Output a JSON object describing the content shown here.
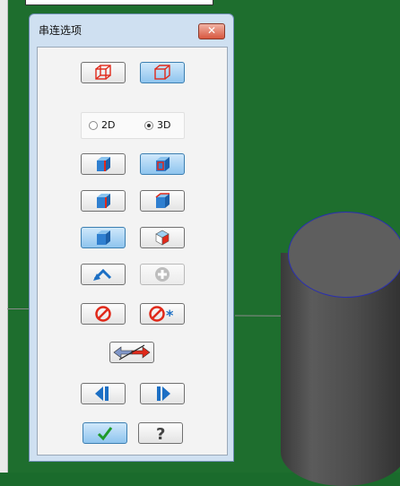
{
  "dialog": {
    "title": "串连选项",
    "close_label": "✕",
    "dimension": {
      "options": [
        "2D",
        "3D"
      ],
      "selected": "3D"
    }
  },
  "icons": {
    "wireframe_cube": "wireframe-cube-icon",
    "solid_cube": "solid-cube-icon",
    "face_cube": "face-cube-icon",
    "undo": "undo-arrow-icon",
    "add": "plus-circle-icon",
    "no": "prohibit-icon",
    "no_star": "prohibit-star-icon",
    "reverse": "reverse-arrow-icon",
    "prev": "prev-icon",
    "next": "next-icon",
    "ok": "checkmark-icon",
    "help": "help-icon"
  },
  "colors": {
    "accent": "#3c7fb1",
    "red": "#e0291a",
    "green": "#1a6b2c"
  }
}
